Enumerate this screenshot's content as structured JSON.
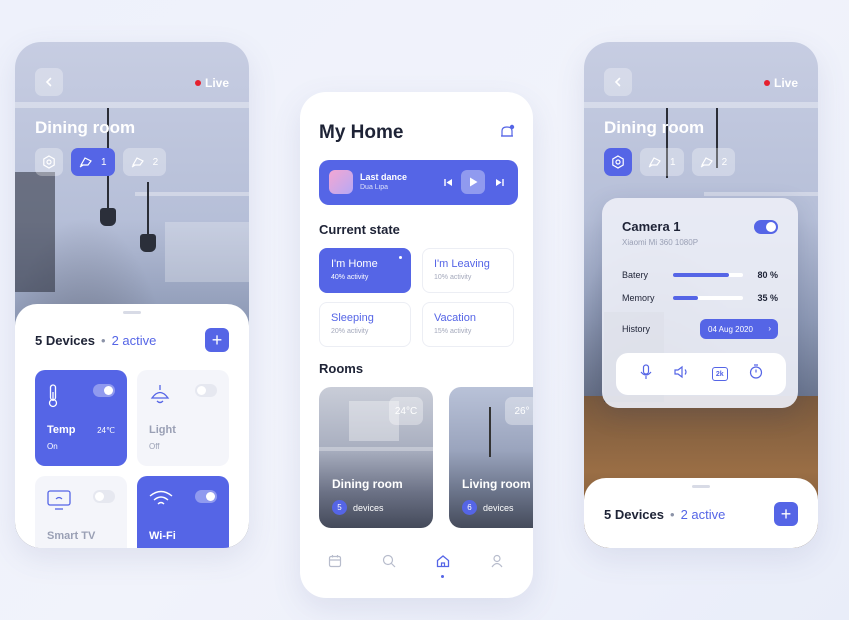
{
  "colors": {
    "accent": "#5565e6",
    "live": "#e5202e",
    "text": "#1e2336",
    "muted": "#9aa0b5"
  },
  "left": {
    "live": "Live",
    "room_title": "Dining room",
    "chips": [
      {
        "icon": "settings-hex-icon"
      },
      {
        "icon": "camera-icon",
        "count": "1"
      },
      {
        "icon": "camera-icon",
        "count": "2"
      }
    ],
    "devices_count": "5 Devices",
    "separator": "•",
    "active_count": "2 active",
    "add_label": "+",
    "tiles": [
      {
        "name": "Temp",
        "sub": "On",
        "extra": "24℃",
        "on": true,
        "icon": "thermometer-icon"
      },
      {
        "name": "Light",
        "sub": "Off",
        "on": false,
        "icon": "lamp-icon"
      },
      {
        "name": "Smart TV",
        "on": false,
        "icon": "tv-icon"
      },
      {
        "name": "Wi-Fi",
        "on": true,
        "icon": "wifi-icon"
      }
    ]
  },
  "middle": {
    "title": "My Home",
    "player": {
      "song": "Last dance",
      "artist": "Dua Lipa"
    },
    "current_state_label": "Current state",
    "modes": [
      {
        "label": "I'm Home",
        "activity": "40% activity",
        "active": true
      },
      {
        "label": "I'm Leaving",
        "activity": "10% activity",
        "active": false
      },
      {
        "label": "Sleeping",
        "activity": "20% activity",
        "active": false
      },
      {
        "label": "Vacation",
        "activity": "15% activity",
        "active": false
      }
    ],
    "rooms_label": "Rooms",
    "rooms": [
      {
        "name": "Dining room",
        "temp": "24°C",
        "devices": "5",
        "devices_label": "devices"
      },
      {
        "name": "Living room",
        "temp": "26°",
        "devices": "6",
        "devices_label": "devices"
      }
    ],
    "nav": [
      "calendar-icon",
      "search-icon",
      "home-icon",
      "user-icon"
    ]
  },
  "right": {
    "live": "Live",
    "room_title": "Dining room",
    "chips": [
      {
        "icon": "settings-hex-icon"
      },
      {
        "icon": "camera-icon",
        "count": "1"
      },
      {
        "icon": "camera-icon",
        "count": "2"
      }
    ],
    "camera": {
      "name": "Camera 1",
      "model": "Xiaomi Mi 360 1080P",
      "battery_label": "Batery",
      "battery": "80 %",
      "battery_level": 0.8,
      "memory_label": "Memory",
      "memory": "35 %",
      "memory_level": 0.35,
      "history_label": "History",
      "history_date": "04 Aug 2020",
      "tools": [
        "microphone-icon",
        "volume-icon",
        "2k-icon",
        "timer-icon"
      ],
      "tool_2k": "2k"
    },
    "devices_count": "5 Devices",
    "separator": "•",
    "active_count": "2 active",
    "add_label": "+"
  }
}
